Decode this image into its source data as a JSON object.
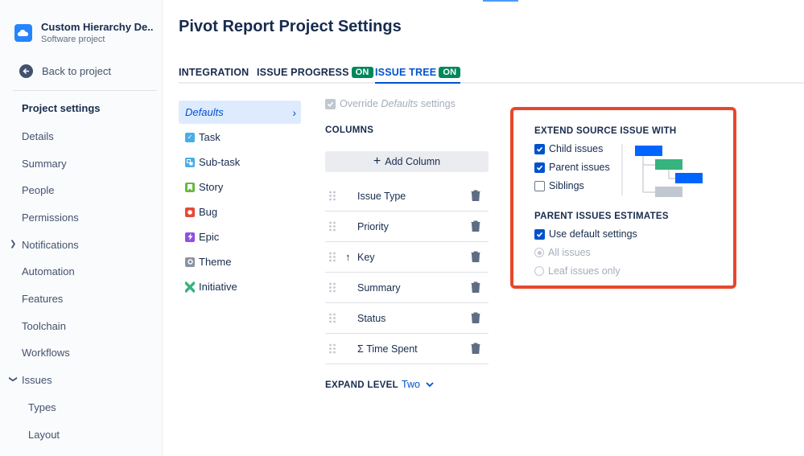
{
  "sidebar": {
    "project_name": "Custom Hierarchy De...",
    "project_type": "Software project",
    "back_label": "Back to project",
    "section_title": "Project settings",
    "items": [
      {
        "label": "Details"
      },
      {
        "label": "Summary"
      },
      {
        "label": "People"
      },
      {
        "label": "Permissions"
      },
      {
        "label": "Notifications"
      },
      {
        "label": "Automation"
      },
      {
        "label": "Features"
      },
      {
        "label": "Toolchain"
      },
      {
        "label": "Workflows"
      },
      {
        "label": "Issues"
      }
    ],
    "sub_items": [
      {
        "label": "Types"
      },
      {
        "label": "Layout"
      }
    ]
  },
  "header": {
    "title": "Pivot Report Project Settings"
  },
  "tabs": [
    {
      "label": "INTEGRATION"
    },
    {
      "label": "ISSUE PROGRESS",
      "badge": "ON"
    },
    {
      "label": "ISSUE TREE",
      "badge": "ON",
      "active": true
    }
  ],
  "issue_types": [
    {
      "label": "Defaults",
      "selected": true
    },
    {
      "label": "Task",
      "color": "#4bade8"
    },
    {
      "label": "Sub-task",
      "color": "#4bade8"
    },
    {
      "label": "Story",
      "color": "#63ba3c"
    },
    {
      "label": "Bug",
      "color": "#e5493a"
    },
    {
      "label": "Epic",
      "color": "#904ee2"
    },
    {
      "label": "Theme",
      "color": "#8993a4"
    },
    {
      "label": "Initiative",
      "color": "#36b37e"
    }
  ],
  "override": {
    "prefix": "Override ",
    "em": "Defaults",
    "suffix": " settings"
  },
  "columns": {
    "heading": "COLUMNS",
    "add_label": "Add Column",
    "items": [
      {
        "label": "Issue Type"
      },
      {
        "label": "Priority"
      },
      {
        "label": "Key",
        "sort_arrow": "↑"
      },
      {
        "label": "Summary"
      },
      {
        "label": "Status"
      },
      {
        "label": "Σ Time Spent"
      }
    ]
  },
  "expand_level": {
    "label": "EXPAND LEVEL",
    "value": "Two"
  },
  "extend": {
    "heading": "EXTEND SOURCE ISSUE WITH",
    "options": [
      {
        "label": "Child issues",
        "checked": true
      },
      {
        "label": "Parent issues",
        "checked": true
      },
      {
        "label": "Siblings",
        "checked": false
      }
    ]
  },
  "estimates": {
    "heading": "PARENT ISSUES ESTIMATES",
    "use_default": "Use default settings",
    "all_issues": "All issues",
    "leaf_only": "Leaf issues only"
  },
  "colors": {
    "accent": "#0052cc",
    "on_badge": "#00875a",
    "highlight": "#e8472b",
    "tree_blue": "#0065ff",
    "tree_green": "#36b37e",
    "tree_gray": "#c1c7d0"
  }
}
